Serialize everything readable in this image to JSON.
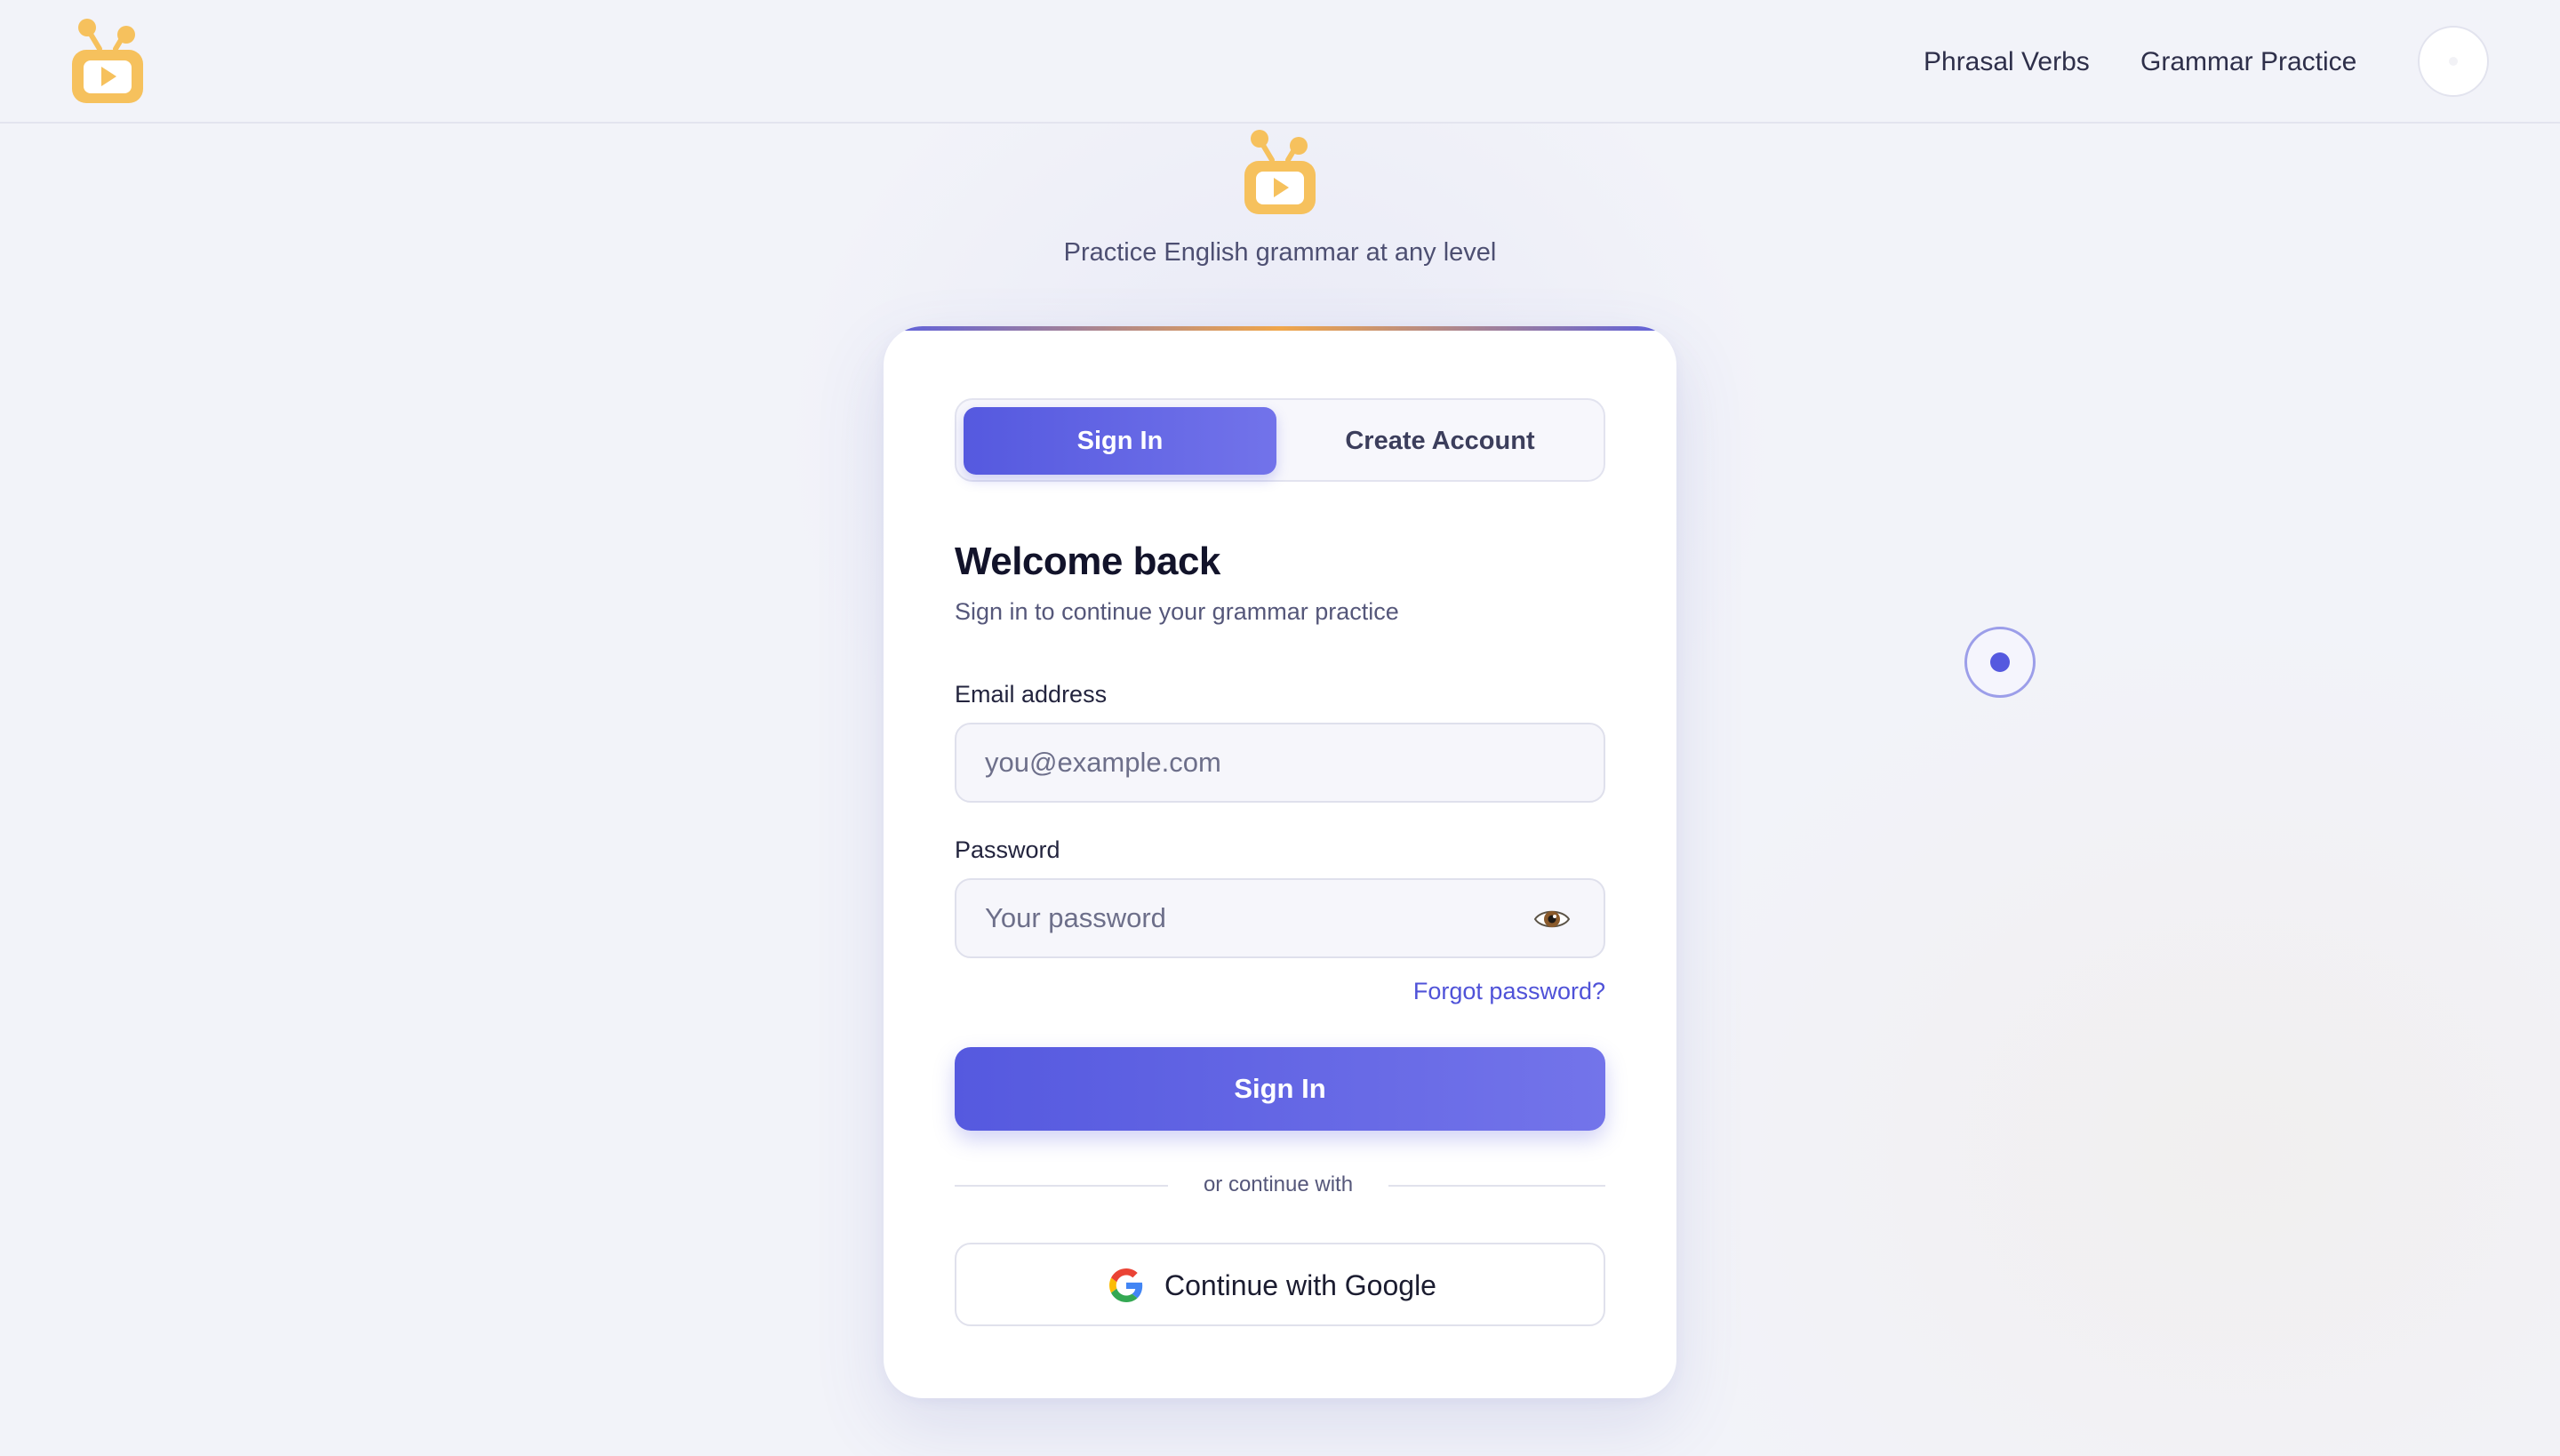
{
  "header": {
    "logo_icon": "tv-play-icon",
    "nav": [
      {
        "label": "Phrasal Verbs"
      },
      {
        "label": "Grammar Practice"
      }
    ],
    "avatar_icon": "user-avatar"
  },
  "hero": {
    "logo_icon": "tv-play-icon",
    "tagline": "Practice English grammar at any level"
  },
  "auth": {
    "tabs": [
      {
        "label": "Sign In",
        "active": true
      },
      {
        "label": "Create Account",
        "active": false
      }
    ],
    "heading": "Welcome back",
    "subheading": "Sign in to continue your grammar practice",
    "email": {
      "label": "Email address",
      "value": "",
      "placeholder": "you@example.com"
    },
    "password": {
      "label": "Password",
      "value": "",
      "placeholder": "Your password",
      "toggle_icon": "eye-icon"
    },
    "forgot_label": "Forgot password?",
    "submit_label": "Sign In",
    "divider_label": "or continue with",
    "google_label": "Continue with Google",
    "google_icon": "google-g-icon"
  },
  "colors": {
    "accent": "#5559df",
    "accent_light": "#7374ea",
    "brand_logo": "#f6c15d",
    "link": "#4f52d8",
    "background": "#f2f3f9"
  }
}
